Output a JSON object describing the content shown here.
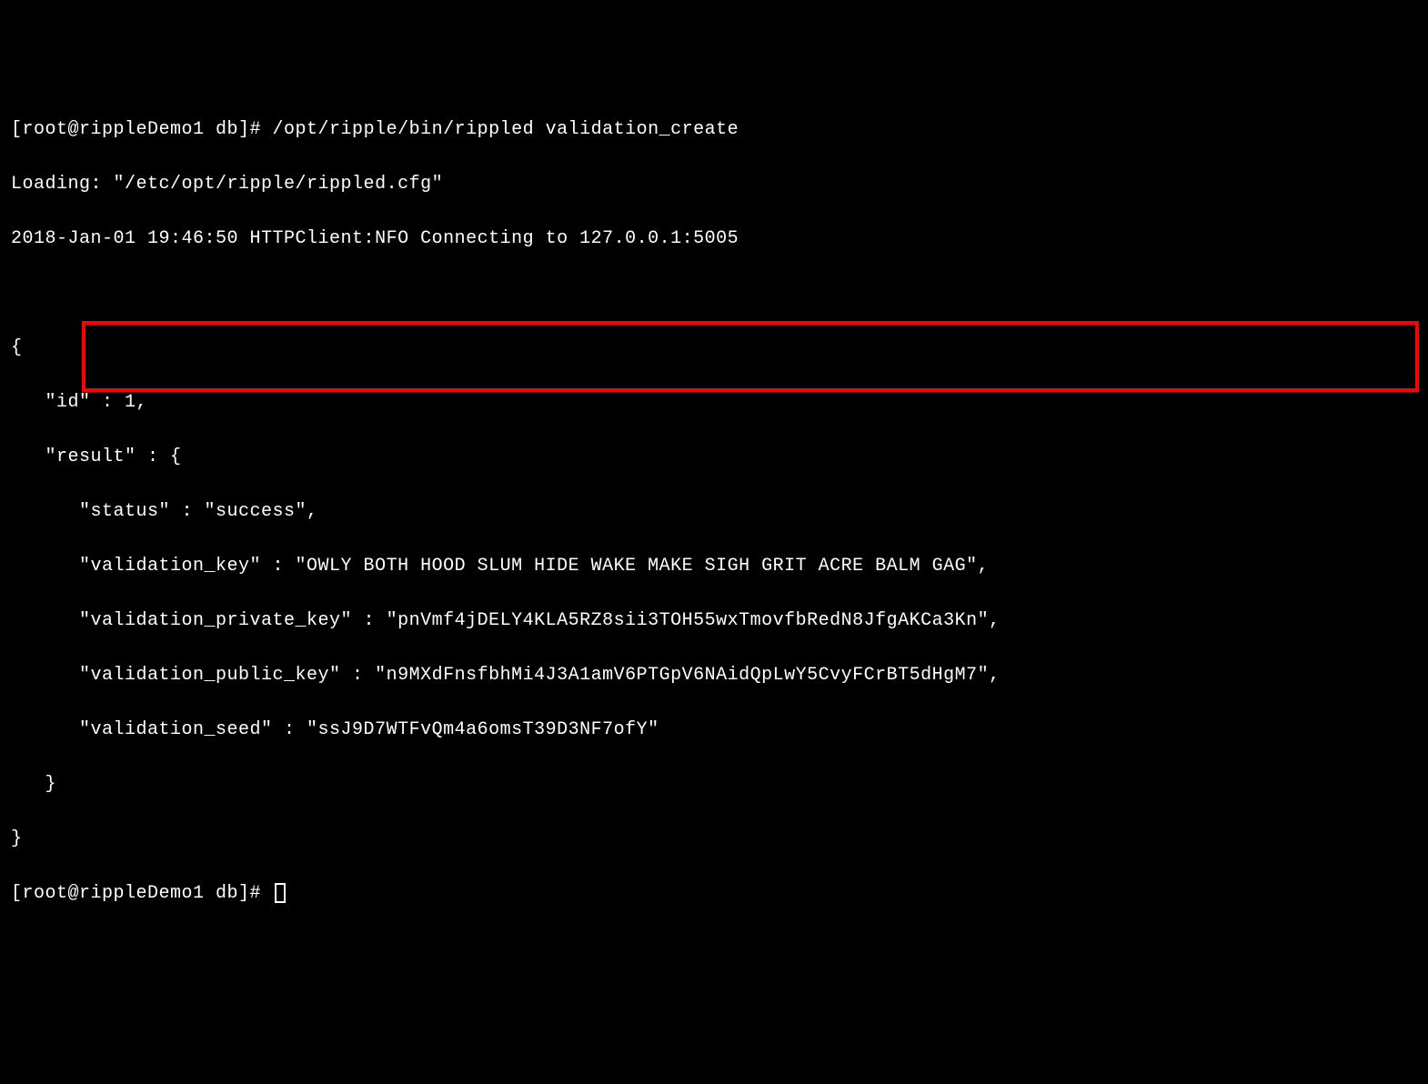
{
  "term": {
    "prompt1": "[root@rippleDemo1 db]# ",
    "command1": "/opt/ripple/bin/rippled validation_create",
    "loading": "Loading: \"/etc/opt/ripple/rippled.cfg\"",
    "logline": "2018-Jan-01 19:46:50 HTTPClient:NFO Connecting to 127.0.0.1:5005",
    "json_open": "{",
    "id_line": "   \"id\" : 1,",
    "result_open": "   \"result\" : {",
    "status_line": "      \"status\" : \"success\",",
    "vkey_line": "      \"validation_key\" : \"OWLY BOTH HOOD SLUM HIDE WAKE MAKE SIGH GRIT ACRE BALM GAG\",",
    "vpriv_line": "      \"validation_private_key\" : \"pnVmf4jDELY4KLA5RZ8sii3TOH55wxTmovfbRedN8JfgAKCa3Kn\",",
    "vpub_line": "      \"validation_public_key\" : \"n9MXdFnsfbhMi4J3A1amV6PTGpV6NAidQpLwY5CvyFCrBT5dHgM7\",",
    "vseed_line": "      \"validation_seed\" : \"ssJ9D7WTFvQm4a6omsT39D3NF7ofY\"",
    "result_close": "   }",
    "json_close": "}",
    "prompt2": "[root@rippleDemo1 db]# "
  }
}
